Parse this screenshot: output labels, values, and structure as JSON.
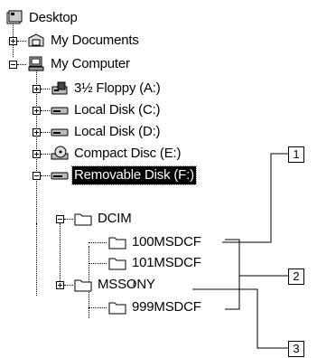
{
  "tree": {
    "desktop": "Desktop",
    "my_documents": "My Documents",
    "my_computer": "My Computer",
    "floppy": "3½ Floppy (A:)",
    "local_c": "Local Disk (C:)",
    "local_d": "Local Disk (D:)",
    "compact_disc": "Compact Disc (E:)",
    "removable": "Removable Disk (F:)",
    "dcim": "DCIM",
    "folder_100": "100MSDCF",
    "folder_101": "101MSDCF",
    "ellipsis": "≀",
    "folder_999": "999MSDCF",
    "mssony": "MSSONY"
  },
  "callouts": [
    "1",
    "2",
    "3"
  ]
}
